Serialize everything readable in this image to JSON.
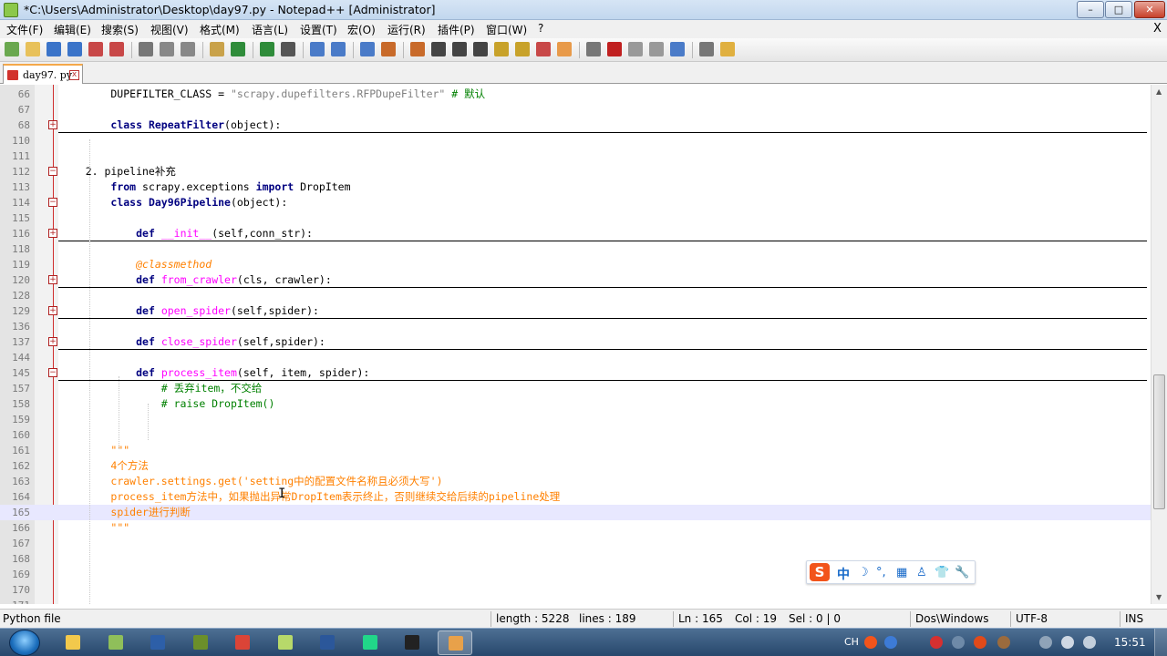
{
  "window": {
    "title": "*C:\\Users\\Administrator\\Desktop\\day97.py - Notepad++ [Administrator]",
    "min_glyph": "–",
    "max_glyph": "□",
    "close_glyph": "✕"
  },
  "menu": {
    "items": [
      "文件(F)",
      "编辑(E)",
      "搜索(S)",
      "视图(V)",
      "格式(M)",
      "语言(L)",
      "设置(T)",
      "宏(O)",
      "运行(R)",
      "插件(P)",
      "窗口(W)",
      "?"
    ],
    "close_label": "X"
  },
  "toolbar": {
    "icons": [
      "new-file-icon",
      "open-file-icon",
      "save-icon",
      "save-all-icon",
      "close-icon",
      "close-all-icon",
      "print-icon",
      "cut-icon",
      "copy-icon",
      "paste-icon",
      "undo-icon",
      "redo-icon",
      "find-icon",
      "replace-icon",
      "zoom-in-icon",
      "zoom-out-icon",
      "sync-vertical-icon",
      "sync-horizontal-icon",
      "word-wrap-icon",
      "show-all-chars-icon",
      "indent-guide-icon",
      "user-lang-icon",
      "doc-map-icon",
      "function-list-icon",
      "folder-as-workspace-icon",
      "monitoring-icon",
      "record-macro-icon",
      "stop-record-icon",
      "play-macro-icon",
      "run-macro-multiple-icon",
      "save-macro-icon",
      "plugin-icon"
    ]
  },
  "tab": {
    "label": "day97. py",
    "close_glyph": "x"
  },
  "editor": {
    "lines": [
      {
        "n": "66",
        "fold": "",
        "foldline": false,
        "current": false,
        "html": "        DUPEFILTER_CLASS = <span class=\"c-str\">\"scrapy.dupefilters.RFPDupeFilter\"</span> <span class=\"c-cm\"># 默认</span>"
      },
      {
        "n": "67",
        "fold": "",
        "foldline": false,
        "current": false,
        "html": ""
      },
      {
        "n": "68",
        "fold": "+",
        "foldline": true,
        "current": false,
        "html": "        <span class=\"c-kw\">class</span> <span class=\"c-kw\">RepeatFilter</span>(object):"
      },
      {
        "n": "110",
        "fold": "",
        "foldline": false,
        "current": false,
        "html": ""
      },
      {
        "n": "111",
        "fold": "",
        "foldline": false,
        "current": false,
        "html": ""
      },
      {
        "n": "112",
        "fold": "-",
        "foldline": false,
        "current": false,
        "html": "    2. pipeline补充"
      },
      {
        "n": "113",
        "fold": "",
        "foldline": false,
        "current": false,
        "html": "        <span class=\"c-kw\">from</span> scrapy.exceptions <span class=\"c-kw\">import</span> DropItem"
      },
      {
        "n": "114",
        "fold": "-",
        "foldline": false,
        "current": false,
        "html": "        <span class=\"c-kw\">class</span> <span class=\"c-kw\">Day96Pipeline</span>(object):"
      },
      {
        "n": "115",
        "fold": "",
        "foldline": false,
        "current": false,
        "html": ""
      },
      {
        "n": "116",
        "fold": "+",
        "foldline": true,
        "current": false,
        "html": "            <span class=\"c-kw\">def</span> <span class=\"c-fn\">__init__</span>(self,conn_str):"
      },
      {
        "n": "118",
        "fold": "",
        "foldline": false,
        "current": false,
        "html": ""
      },
      {
        "n": "119",
        "fold": "",
        "foldline": false,
        "current": false,
        "html": "            <span class=\"c-dec\">@classmethod</span>"
      },
      {
        "n": "120",
        "fold": "+",
        "foldline": true,
        "current": false,
        "html": "            <span class=\"c-kw\">def</span> <span class=\"c-fn\">from_crawler</span>(cls, crawler):"
      },
      {
        "n": "128",
        "fold": "",
        "foldline": false,
        "current": false,
        "html": ""
      },
      {
        "n": "129",
        "fold": "+",
        "foldline": true,
        "current": false,
        "html": "            <span class=\"c-kw\">def</span> <span class=\"c-fn\">open_spider</span>(self,spider):"
      },
      {
        "n": "136",
        "fold": "",
        "foldline": false,
        "current": false,
        "html": ""
      },
      {
        "n": "137",
        "fold": "+",
        "foldline": true,
        "current": false,
        "html": "            <span class=\"c-kw\">def</span> <span class=\"c-fn\">close_spider</span>(self,spider):"
      },
      {
        "n": "144",
        "fold": "",
        "foldline": false,
        "current": false,
        "html": ""
      },
      {
        "n": "145",
        "fold": "-",
        "foldline": true,
        "current": false,
        "html": "            <span class=\"c-kw\">def</span> <span class=\"c-fn\">process_item</span>(self, item, spider):"
      },
      {
        "n": "157",
        "fold": "",
        "foldline": false,
        "current": false,
        "html": "                <span class=\"c-cm\"># 丢弃item，不交给</span>"
      },
      {
        "n": "158",
        "fold": "",
        "foldline": false,
        "current": false,
        "html": "                <span class=\"c-cm\"># raise DropItem()</span>"
      },
      {
        "n": "159",
        "fold": "",
        "foldline": false,
        "current": false,
        "html": ""
      },
      {
        "n": "160",
        "fold": "",
        "foldline": false,
        "current": false,
        "html": ""
      },
      {
        "n": "161",
        "fold": "",
        "foldline": false,
        "current": false,
        "html": "        <span class=\"c-doc\">\"\"\"</span>"
      },
      {
        "n": "162",
        "fold": "",
        "foldline": false,
        "current": false,
        "html": "        <span class=\"c-doc\">4个方法</span>"
      },
      {
        "n": "163",
        "fold": "",
        "foldline": false,
        "current": false,
        "html": "        <span class=\"c-doc\">crawler.settings.get('setting中的配置文件名称且必须大写')</span>"
      },
      {
        "n": "164",
        "fold": "",
        "foldline": false,
        "current": false,
        "html": "        <span class=\"c-doc\">process_item方法中，如果抛出异常DropItem表示终止，否则继续交给后续的pipeline处理</span>"
      },
      {
        "n": "165",
        "fold": "",
        "foldline": false,
        "current": true,
        "html": "        <span class=\"c-doc\">spider进行判断</span>"
      },
      {
        "n": "166",
        "fold": "",
        "foldline": false,
        "current": false,
        "html": "        <span class=\"c-doc\">\"\"\"</span>"
      },
      {
        "n": "167",
        "fold": "",
        "foldline": false,
        "current": false,
        "html": ""
      },
      {
        "n": "168",
        "fold": "",
        "foldline": false,
        "current": false,
        "html": ""
      },
      {
        "n": "169",
        "fold": "",
        "foldline": false,
        "current": false,
        "html": ""
      },
      {
        "n": "170",
        "fold": "",
        "foldline": false,
        "current": false,
        "html": ""
      },
      {
        "n": "171",
        "fold": "",
        "foldline": false,
        "current": false,
        "html": ""
      }
    ]
  },
  "ime": {
    "logo": "S",
    "mode": "中",
    "icons": [
      "moon-icon",
      "punctuation-icon",
      "keyboard-icon",
      "user-icon",
      "skin-icon",
      "wrench-icon"
    ],
    "glyphs": [
      "☽",
      "°,",
      "▦",
      "♙",
      "👕",
      "🔧"
    ]
  },
  "status": {
    "file_type": "Python file",
    "length": "length : 5228",
    "lines": "lines : 189",
    "ln": "Ln : 165",
    "col": "Col : 19",
    "sel": "Sel : 0 | 0",
    "eol": "Dos\\Windows",
    "encoding": "UTF-8",
    "mode": "INS"
  },
  "taskbar": {
    "apps": [
      "folder-icon",
      "paint-icon",
      "save-icon",
      "network-icon",
      "chrome-icon",
      "notepad-plus-icon",
      "word-icon",
      "pycharm-icon",
      "cmd-icon",
      "screen-capture-icon"
    ],
    "active_index": 9,
    "lang": "CH",
    "clock": "15:51"
  },
  "colors": {
    "accent": "#f4a84a",
    "keyword": "#000080",
    "comment": "#008000",
    "docstring": "#ff8000",
    "function": "#ff00ff"
  }
}
